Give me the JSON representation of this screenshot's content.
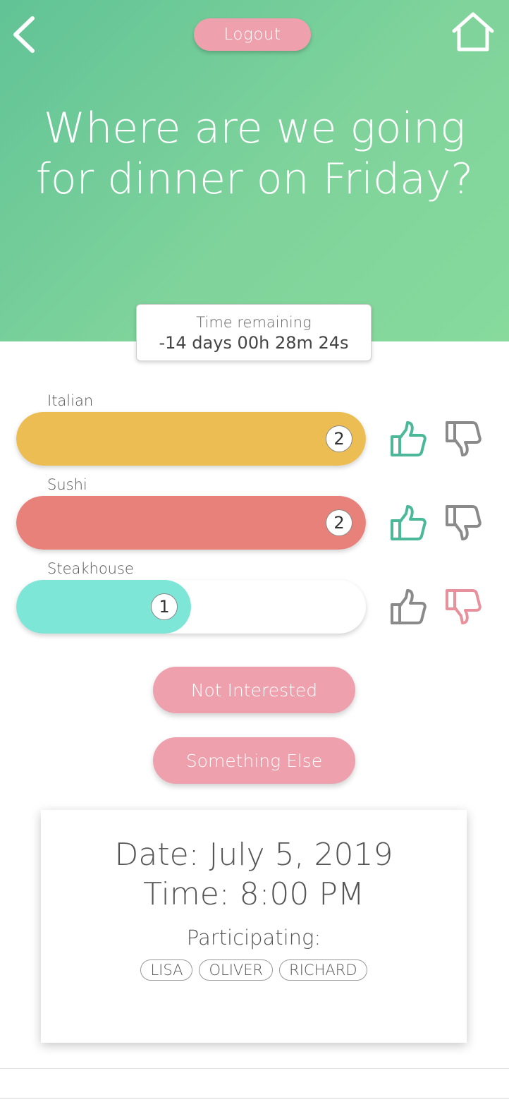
{
  "header": {
    "logout_label": "Logout",
    "title": "Where are we going for dinner on Friday?",
    "gradient_start": "#61c396",
    "gradient_end": "#87da9c"
  },
  "timer": {
    "label": "Time remaining",
    "value": "-14 days 00h 28m 24s"
  },
  "options": [
    {
      "label": "Italian",
      "count": "2",
      "fill_fraction": 1.0,
      "color": "#ebbd52",
      "thumb_up": "active",
      "thumb_down": "neutral"
    },
    {
      "label": "Sushi",
      "count": "2",
      "fill_fraction": 1.0,
      "color": "#e8817a",
      "thumb_up": "active",
      "thumb_down": "neutral"
    },
    {
      "label": "Steakhouse",
      "count": "1",
      "fill_fraction": 0.5,
      "color": "#7de6d7",
      "thumb_up": "neutral",
      "thumb_down": "active"
    }
  ],
  "actions": {
    "not_interested_label": "Not Interested",
    "something_else_label": "Something Else"
  },
  "event": {
    "date": "Date: July 5, 2019",
    "time": "Time: 8:00 PM",
    "participating_label": "Participating:",
    "participants": [
      "LISA",
      "OLIVER",
      "RICHARD"
    ]
  },
  "colors": {
    "accent_pink": "#eea0ad",
    "thumb_up_active": "#4bb89a",
    "thumb_down_active": "#e8919c",
    "thumb_neutral": "#8a8a8a"
  },
  "icons": {
    "back": "chevron-left-icon",
    "home": "home-icon",
    "thumb_up": "thumbs-up-icon",
    "thumb_down": "thumbs-down-icon"
  }
}
